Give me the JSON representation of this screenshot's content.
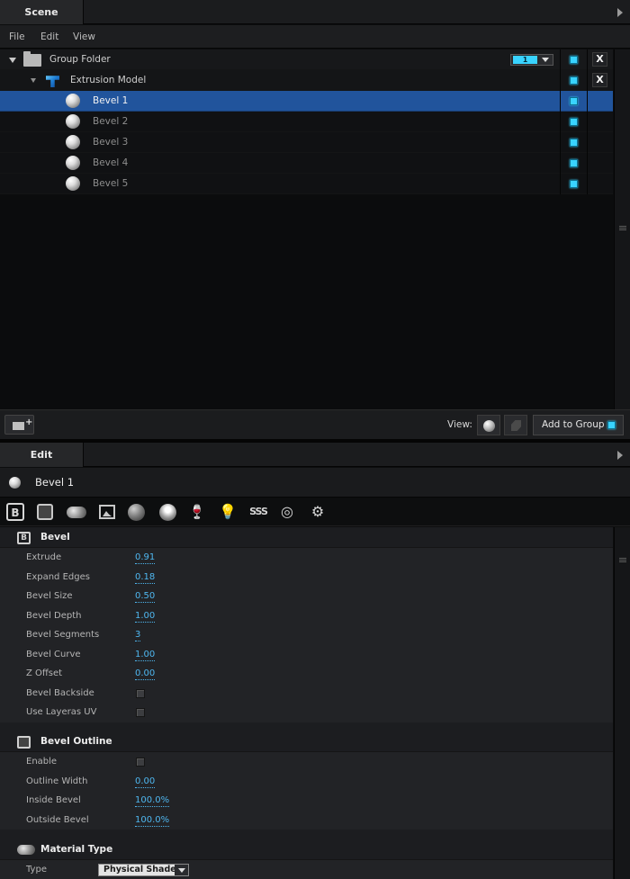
{
  "scene_panel": {
    "tab_label": "Scene",
    "menu": {
      "file": "File",
      "edit": "Edit",
      "view": "View"
    },
    "group_folder": {
      "label": "Group Folder",
      "count": "1",
      "close": "X"
    },
    "extrusion_model": {
      "label": "Extrusion Model",
      "close": "X"
    },
    "bevels": [
      {
        "label": "Bevel 1",
        "selected": true
      },
      {
        "label": "Bevel 2",
        "selected": false
      },
      {
        "label": "Bevel 3",
        "selected": false
      },
      {
        "label": "Bevel 4",
        "selected": false
      },
      {
        "label": "Bevel 5",
        "selected": false
      }
    ],
    "toolbar": {
      "view_label": "View:",
      "add_to_group": "Add to Group"
    },
    "visibility_color": "#39d3ff",
    "selection_color": "#21549c"
  },
  "edit_panel": {
    "tab_label": "Edit",
    "title": "Bevel 1",
    "tool_icons": [
      "bevel-icon",
      "bevel-outline-icon",
      "material-type-icon",
      "texture-icon",
      "sphere-material-icon",
      "reflection-icon",
      "glass-icon",
      "light-bulb-icon",
      "sss-icon",
      "wireframe-sphere-icon",
      "gear-icon"
    ],
    "bevel_section": {
      "title": "Bevel",
      "props": {
        "extrude": {
          "label": "Extrude",
          "value": "0.91"
        },
        "expand_edges": {
          "label": "Expand Edges",
          "value": "0.18"
        },
        "bevel_size": {
          "label": "Bevel Size",
          "value": "0.50"
        },
        "bevel_depth": {
          "label": "Bevel Depth",
          "value": "1.00"
        },
        "bevel_segments": {
          "label": "Bevel Segments",
          "value": "3"
        },
        "bevel_curve": {
          "label": "Bevel Curve",
          "value": "1.00"
        },
        "z_offset": {
          "label": "Z Offset",
          "value": "0.00"
        },
        "bevel_backside": {
          "label": "Bevel Backside"
        },
        "use_layer_uv": {
          "label": "Use Layeras UV"
        }
      }
    },
    "outline_section": {
      "title": "Bevel Outline",
      "props": {
        "enable": {
          "label": "Enable"
        },
        "outline_width": {
          "label": "Outline Width",
          "value": "0.00"
        },
        "inside_bevel": {
          "label": "Inside Bevel",
          "value": "100.0%"
        },
        "outside_bevel": {
          "label": "Outside Bevel",
          "value": "100.0%"
        }
      }
    },
    "material_section": {
      "title": "Material Type",
      "type_label": "Type",
      "type_value": "Physical Shader"
    },
    "value_color": "#4fb7f0"
  }
}
